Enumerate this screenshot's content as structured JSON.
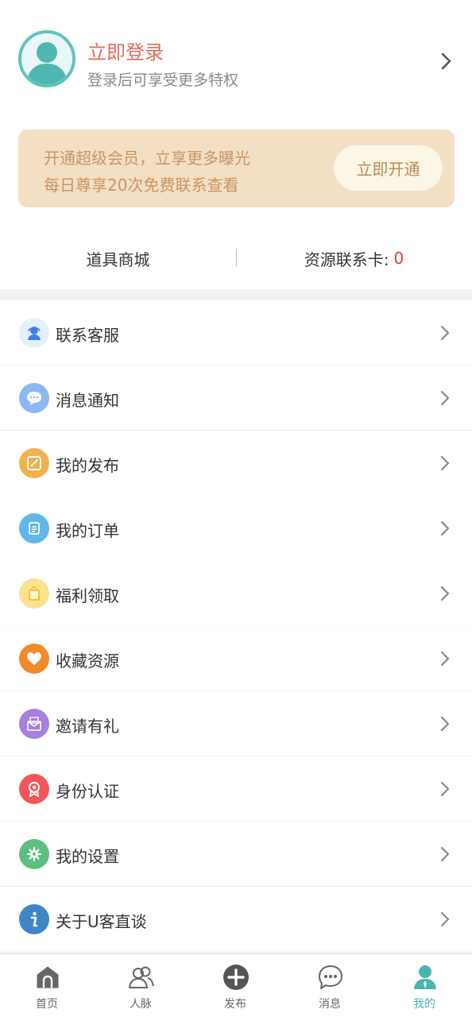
{
  "profile": {
    "login_title": "立即登录",
    "login_subtitle": "登录后可享受更多特权",
    "avatar_icon": "user-avatar-icon"
  },
  "vip_banner": {
    "line1": "开通超级会员，立享更多曝光",
    "line2": "每日尊享20次免费联系查看",
    "button_label": "立即开通",
    "background": "#f3dfc4",
    "text_color": "#c99463"
  },
  "shop": {
    "left_label": "道具商城",
    "right_label": "资源联系卡:",
    "right_count": "0"
  },
  "menu": {
    "items": [
      {
        "label": "联系客服",
        "icon": "customer-service-icon",
        "color": "#e6f0fd"
      },
      {
        "label": "消息通知",
        "icon": "message-bubble-icon",
        "color": "#8ab8f5"
      },
      {
        "label": "我的发布",
        "icon": "edit-icon",
        "color": "#f1b14e"
      },
      {
        "label": "我的订单",
        "icon": "order-icon",
        "color": "#5fb7ea"
      },
      {
        "label": "福利领取",
        "icon": "gift-bag-icon",
        "color": "#fbd766"
      },
      {
        "label": "收藏资源",
        "icon": "heart-icon",
        "color": "#f08a2a"
      },
      {
        "label": "邀请有礼",
        "icon": "envelope-icon",
        "color": "#a67fe0"
      },
      {
        "label": "身份认证",
        "icon": "badge-icon",
        "color": "#f05757"
      },
      {
        "label": "我的设置",
        "icon": "gear-icon",
        "color": "#5dbf7f"
      },
      {
        "label": "关于U客直谈",
        "icon": "info-icon",
        "color": "#3f86c6"
      }
    ]
  },
  "bottom_nav": {
    "items": [
      {
        "label": "首页",
        "icon": "home-icon",
        "active": false
      },
      {
        "label": "人脉",
        "icon": "contacts-icon",
        "active": false
      },
      {
        "label": "发布",
        "icon": "add-circle-icon",
        "active": false
      },
      {
        "label": "消息",
        "icon": "chat-icon",
        "active": false
      },
      {
        "label": "我的",
        "icon": "profile-icon",
        "active": true
      }
    ],
    "active_color": "#4bb4b0"
  }
}
